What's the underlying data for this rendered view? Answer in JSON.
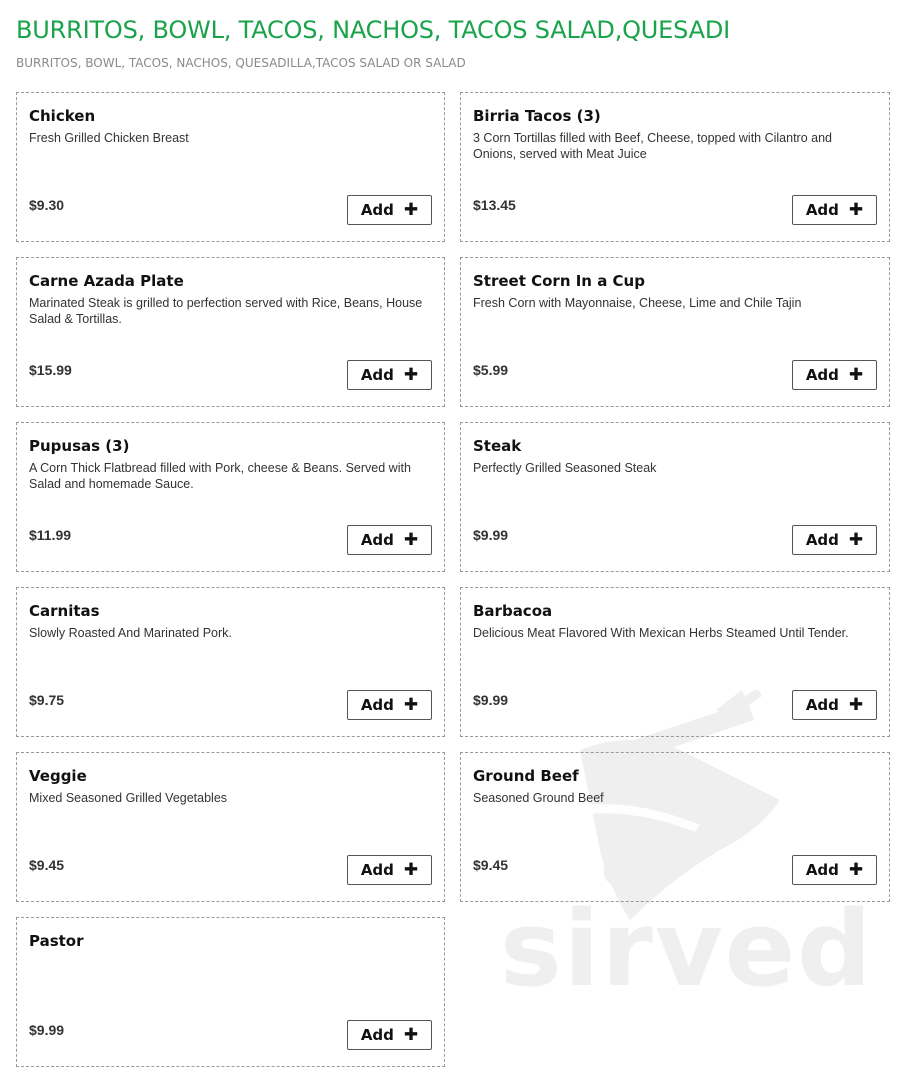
{
  "header": {
    "title": "BURRITOS, BOWL, TACOS, NACHOS, TACOS SALAD,QUESADI",
    "subtitle": "BURRITOS, BOWL, TACOS, NACHOS, QUESADILLA,TACOS SALAD OR SALAD"
  },
  "add_label": "Add",
  "add_icon": "plus-icon",
  "items": [
    {
      "name": "Chicken",
      "description": "Fresh Grilled Chicken Breast",
      "price": "$9.30"
    },
    {
      "name": "Birria Tacos (3)",
      "description": "3 Corn Tortillas filled with Beef, Cheese, topped with Cilantro and Onions, served with Meat Juice",
      "price": "$13.45"
    },
    {
      "name": "Carne Azada Plate",
      "description": "Marinated Steak is grilled to perfection served with Rice, Beans, House Salad & Tortillas.",
      "price": "$15.99"
    },
    {
      "name": "Street Corn In a Cup",
      "description": "Fresh Corn with Mayonnaise, Cheese, Lime and Chile Tajin",
      "price": "$5.99"
    },
    {
      "name": "Pupusas (3)",
      "description": "A Corn Thick Flatbread filled with Pork, cheese & Beans. Served with Salad and homemade Sauce.",
      "price": "$11.99"
    },
    {
      "name": "Steak",
      "description": "Perfectly Grilled Seasoned Steak",
      "price": "$9.99"
    },
    {
      "name": "Carnitas",
      "description": "Slowly Roasted And Marinated Pork.",
      "price": "$9.75"
    },
    {
      "name": "Barbacoa",
      "description": "Delicious Meat Flavored With Mexican Herbs Steamed Until Tender.",
      "price": "$9.99"
    },
    {
      "name": "Veggie",
      "description": "Mixed Seasoned Grilled Vegetables",
      "price": "$9.45"
    },
    {
      "name": "Ground Beef",
      "description": "Seasoned Ground Beef",
      "price": "$9.45"
    },
    {
      "name": "Pastor",
      "description": "",
      "price": "$9.99"
    }
  ],
  "watermark": {
    "text": "sirved",
    "icon": "sirved-logo-icon"
  },
  "colors": {
    "title": "#1aa34a",
    "border": "#9a9a9a",
    "watermark": "#efefef"
  }
}
